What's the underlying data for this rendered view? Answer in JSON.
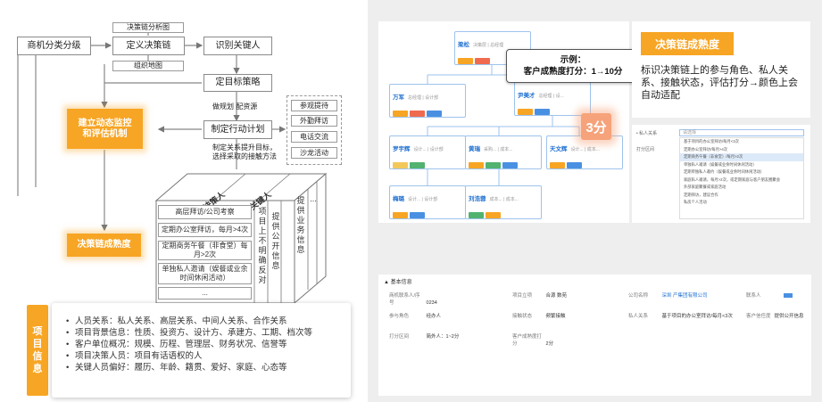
{
  "flow": {
    "classify": "商机分类分级",
    "define_chain": "定义决策链",
    "identify_key": "识别关键人",
    "chain_chart": "决策链分析图",
    "org_map": "组织地图",
    "set_strategy": "定目标策略",
    "monitor": "建立动态监控\n和评估机制",
    "plan_resource": "做规划  配资源",
    "action_plan": "制定行动计划",
    "contact_note": "制定关系提升目标，\n选择采取的接触方法",
    "contact_methods": [
      "参观提待",
      "外勤拜访",
      "电话交流",
      "沙龙活动"
    ],
    "maturity": "决策链成熟度",
    "cube_top_labels": [
      "决策人",
      "关键人"
    ],
    "cube_rows": [
      "高层拜访/公司考察",
      "定期办公室拜访，每月>4次",
      "定期商务午餐（非食堂）每月>2次",
      "单独私人邀请（娱餐或业余时间休闲活动）",
      "..."
    ],
    "cube_cols": [
      "项目上不明确反对",
      "提供公开信息",
      "提供业务信息",
      "..."
    ]
  },
  "project_info": {
    "tab_label": "项目信息",
    "items": [
      "人员关系：私人关系、高层关系、中间人关系、合作关系",
      "项目背景信息：性质、投资方、设计方、承建方、工期、档次等",
      "客户单位概况：规模、历程、管理层、财务状况、信誉等",
      "项目决策人员：项目有话语权的人",
      "关键人员偏好：履历、年龄、籍贯、爱好、家庭、心态等"
    ]
  },
  "tree": {
    "nodes": [
      {
        "name": "梁松",
        "role": "决策层 | 总经理"
      },
      {
        "name": "万军",
        "role": "总经理 | 设计部"
      },
      {
        "name": "尹美才",
        "role": "总经理 | 设..."
      },
      {
        "name": "罗宇辉",
        "role": "设计... | 设计部"
      },
      {
        "name": "黄瑞",
        "role": "采购... | 成本..."
      },
      {
        "name": "天文辉",
        "role": "设计... | 成本..."
      },
      {
        "name": "梅璐",
        "role": "设计... | 设计部"
      },
      {
        "name": "刘浩蓉",
        "role": "成本... | 成本..."
      }
    ],
    "callout": "示例：\n客户成熟度打分：1→10分",
    "score": "3分"
  },
  "maturity_card": {
    "title": "决策链成熟度",
    "desc": "标识决策链上的参与角色、私人关系、接触状态，评估打分→颜色上会自动适配"
  },
  "dropdown": {
    "label1": "• 私人关系",
    "label2": "打分区间",
    "placeholder": "请选择",
    "items": [
      "基于项目的办公室拜访/每月<3次",
      "定期办公室拜访/每月>4次",
      "定期商务午餐（非食堂）/每月>2次",
      "单独私人邀请（娱餐或业余时间休闲活动）",
      "定期单独私人邀约（娱餐或业余时间休闲活动）",
      "家庭私人邀请，每月>2次，或定期家庭与客户朋友圈聚会",
      "外部家庭聚餐或家庭活动",
      "定期拜访，建议合作",
      "私房个人活动"
    ]
  },
  "basic_info": {
    "title": "▲ 基本信息",
    "fields": [
      {
        "k": "商机联系人/序号",
        "v": "0234"
      },
      {
        "k": "项目立项",
        "v": "合源    数苑"
      },
      {
        "k": "公司名称",
        "v": "深圳   产集团有限公司"
      },
      {
        "k": "联系人",
        "v": ""
      },
      {
        "k": "参与角色",
        "v": "经办人"
      },
      {
        "k": "接触状态",
        "v": "频繁接触"
      },
      {
        "k": "私人关系",
        "v": "基于项目的办公室拜访/每月<3次"
      },
      {
        "k": "客户信任度",
        "v": "提供公开信息"
      },
      {
        "k": "打分区间",
        "v": "简外人：1~2分"
      },
      {
        "k": "客户成熟度打分",
        "v": "2分"
      }
    ]
  }
}
